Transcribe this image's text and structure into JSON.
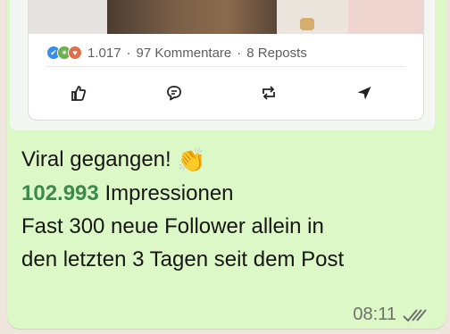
{
  "post": {
    "reaction_icons": [
      "like-reaction-icon",
      "celebrate-reaction-icon",
      "love-reaction-icon"
    ],
    "reactions_count": "1.017",
    "separator": "·",
    "comments": "97 Kommentare",
    "reposts": "8 Reposts",
    "actions": [
      "like-icon",
      "comment-icon",
      "repost-icon",
      "send-icon"
    ]
  },
  "message": {
    "line1": "Viral gegangen!",
    "emoji": "👏",
    "impressions_number": "102.993",
    "impressions_label": "Impressionen",
    "line3": "Fast 300 neue Follower allein in",
    "line4": "den letzten 3 Tagen seit dem Post",
    "time": "08:11",
    "status_icon": "double-check-icon"
  },
  "colors": {
    "bubble": "#dcf8c6",
    "highlight_number": "#3b8a4b",
    "background": "#efe7de"
  }
}
